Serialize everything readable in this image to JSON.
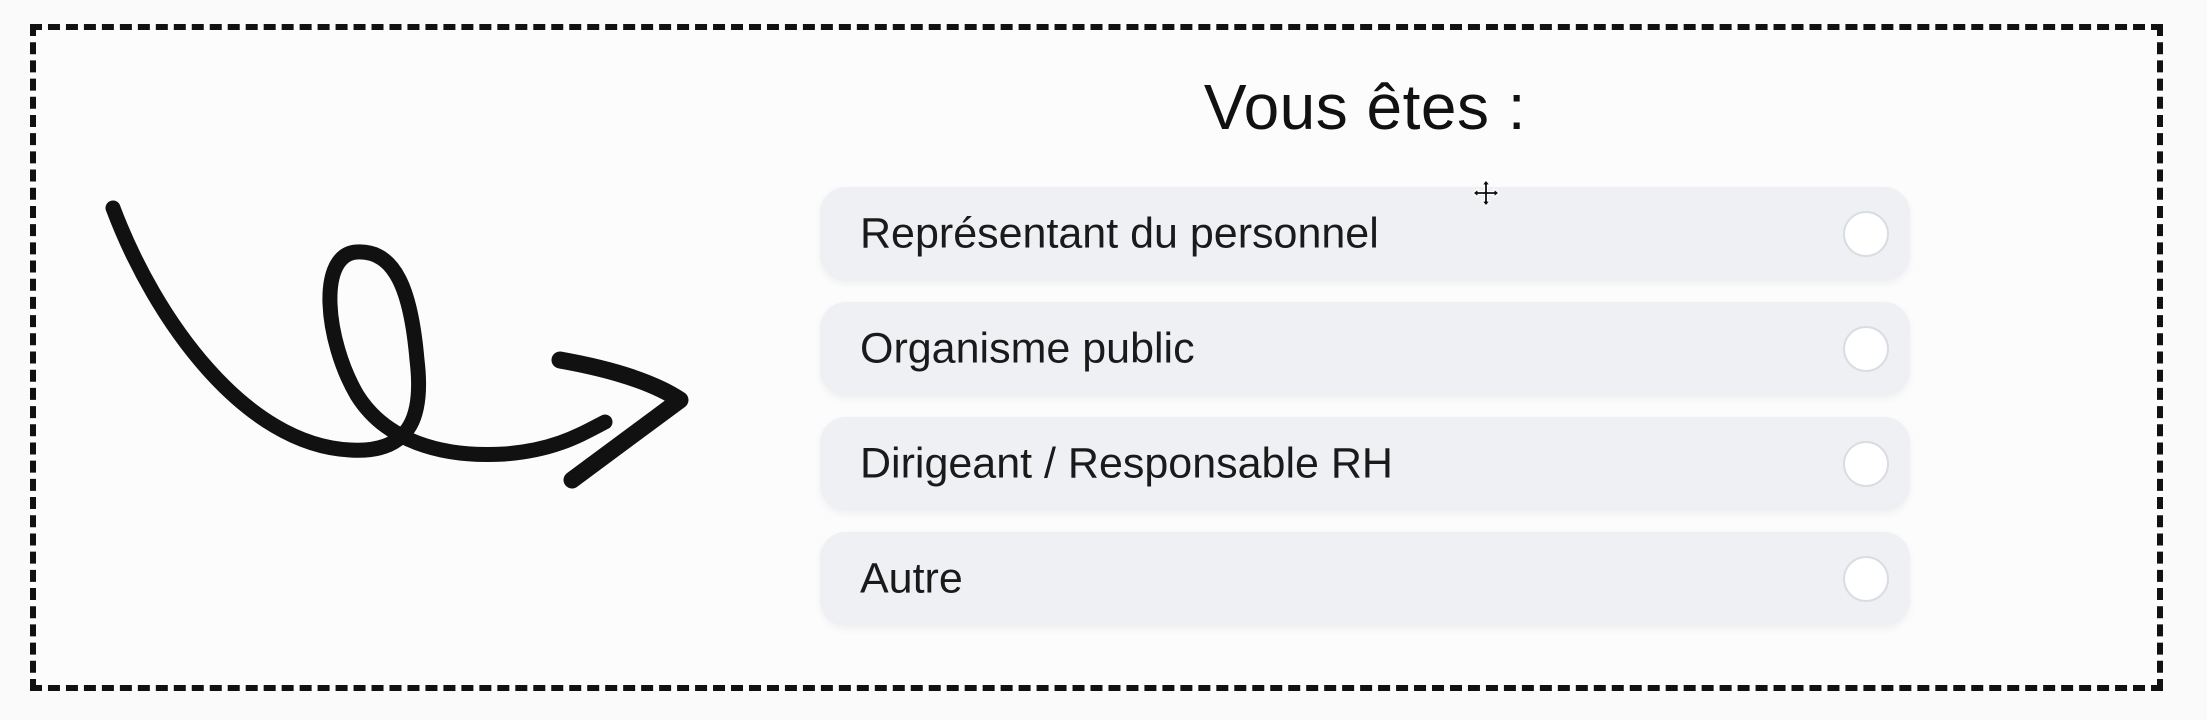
{
  "form": {
    "title": "Vous êtes :",
    "options": [
      {
        "label": "Représentant du personnel",
        "selected": false
      },
      {
        "label": "Organisme public",
        "selected": false
      },
      {
        "label": "Dirigeant / Responsable RH",
        "selected": false
      },
      {
        "label": "Autre",
        "selected": false
      }
    ]
  },
  "decoration": {
    "arrow_icon": "hand-drawn-loop-arrow-icon",
    "cursor_icon": "move-cursor-icon"
  },
  "colors": {
    "border": "#111111",
    "option_background": "#eef0f4",
    "radio_fill": "#ffffff",
    "text": "#1a1a1a"
  }
}
